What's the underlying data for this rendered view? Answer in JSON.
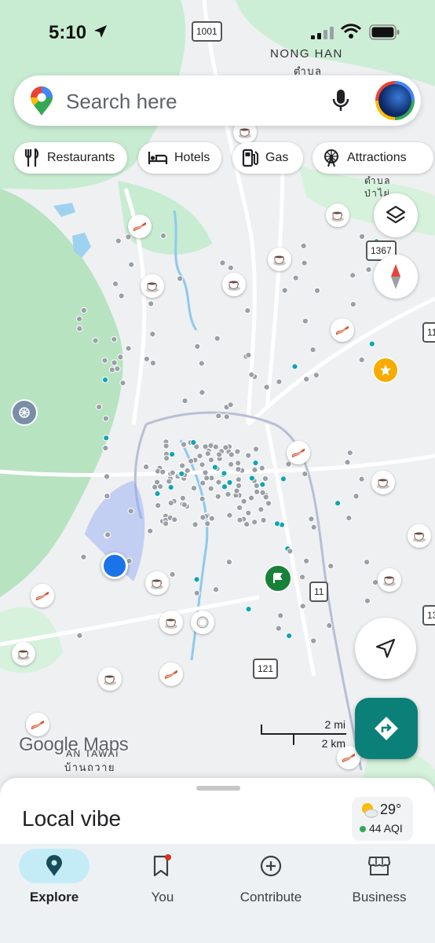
{
  "status_bar": {
    "time": "5:10"
  },
  "search": {
    "placeholder": "Search here"
  },
  "chips": [
    {
      "label": "Restaurants",
      "icon": "fork-knife-icon"
    },
    {
      "label": "Hotels",
      "icon": "bed-icon"
    },
    {
      "label": "Gas",
      "icon": "gas-pump-icon"
    },
    {
      "label": "Attractions",
      "icon": "ferris-wheel-icon"
    }
  ],
  "map": {
    "place_labels": {
      "nong_han": "NONG HAN",
      "nong_han_thai": "ตำบล",
      "pa_phai_thai": "ตำบล\nป่าไผ่",
      "bottom_thai": "บ้านถวาย",
      "bottom_latin": "AN TAWAI"
    },
    "road_shields": {
      "r1001": "1001",
      "r1367": "1367",
      "r11a": "11",
      "r11b": "11",
      "r121": "121",
      "r13": "13"
    },
    "scale": {
      "miles": "2 mi",
      "km": "2 km"
    },
    "logo": "Google Maps"
  },
  "sheet": {
    "title": "Local vibe",
    "weather": {
      "temp": "29°",
      "aqi": "44 AQI"
    }
  },
  "tabs": [
    {
      "label": "Explore",
      "active": true
    },
    {
      "label": "You"
    },
    {
      "label": "Contribute"
    },
    {
      "label": "Business"
    }
  ],
  "colors": {
    "accent": "#0b8078",
    "explore_bg": "#c4ecf7",
    "location_blue": "#1a73e8"
  }
}
